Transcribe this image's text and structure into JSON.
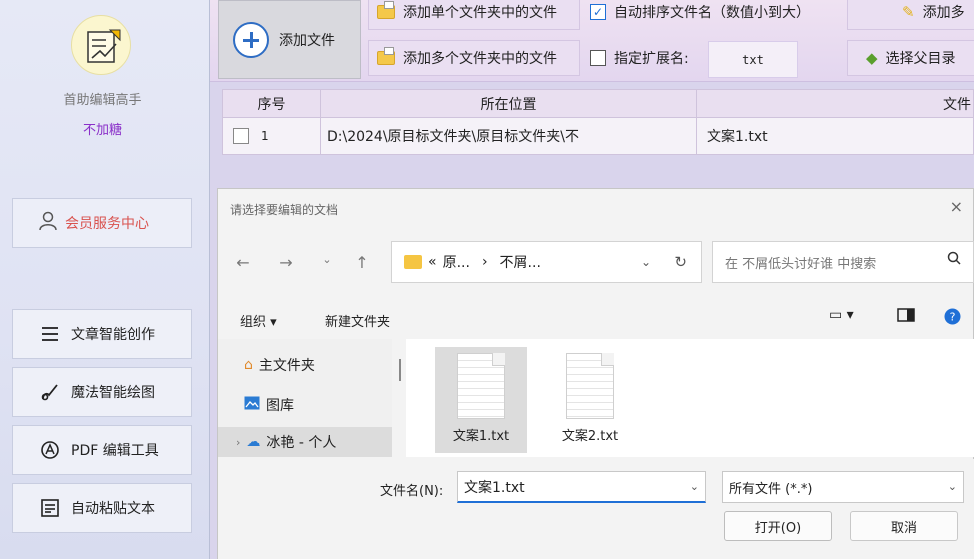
{
  "sidebar": {
    "app_name": "首助编辑高手",
    "subtitle": "不加糖",
    "member_center": "会员服务中心",
    "items": [
      {
        "label": "文章智能创作",
        "icon": "list-icon"
      },
      {
        "label": "魔法智能绘图",
        "icon": "brush-icon"
      },
      {
        "label": "PDF 编辑工具",
        "icon": "pdf-icon"
      },
      {
        "label": "自动粘贴文本",
        "icon": "paste-icon"
      }
    ]
  },
  "toolbar": {
    "add_file": "添加文件",
    "add_single_folder": "添加单个文件夹中的文件",
    "add_multi_folder": "添加多个文件夹中的文件",
    "auto_sort": "自动排序文件名（数值小到大）",
    "auto_sort_checked": true,
    "ext_label": "指定扩展名:",
    "ext_checked": false,
    "ext_value": "txt",
    "add_more": "添加多",
    "choose_parent": "选择父目录"
  },
  "table": {
    "headers": [
      "序号",
      "所在位置",
      "文件"
    ],
    "rows": [
      {
        "index": "1",
        "location": "D:\\2024\\原目标文件夹\\原目标文件夹\\不",
        "name": "文案1.txt"
      }
    ]
  },
  "dialog": {
    "title": "请选择要编辑的文档",
    "close": "×",
    "path": {
      "prefix": "«",
      "part1": "原...",
      "sep": "›",
      "part2": "不屑..."
    },
    "search_placeholder": "在 不屑低头讨好谁 中搜索",
    "organize": "组织 ▾",
    "new_folder": "新建文件夹",
    "nav": [
      {
        "label": "主文件夹",
        "icon": "home-icon"
      },
      {
        "label": "图库",
        "icon": "gallery-icon"
      },
      {
        "label": "冰艳 - 个人",
        "icon": "cloud-icon"
      }
    ],
    "files": [
      {
        "name": "文案1.txt",
        "selected": true
      },
      {
        "name": "文案2.txt",
        "selected": false
      }
    ],
    "filename_label": "文件名(N):",
    "filename_value": "文案1.txt",
    "filetype_value": "所有文件 (*.*)",
    "open_button": "打开(O)",
    "cancel_button": "取消"
  }
}
